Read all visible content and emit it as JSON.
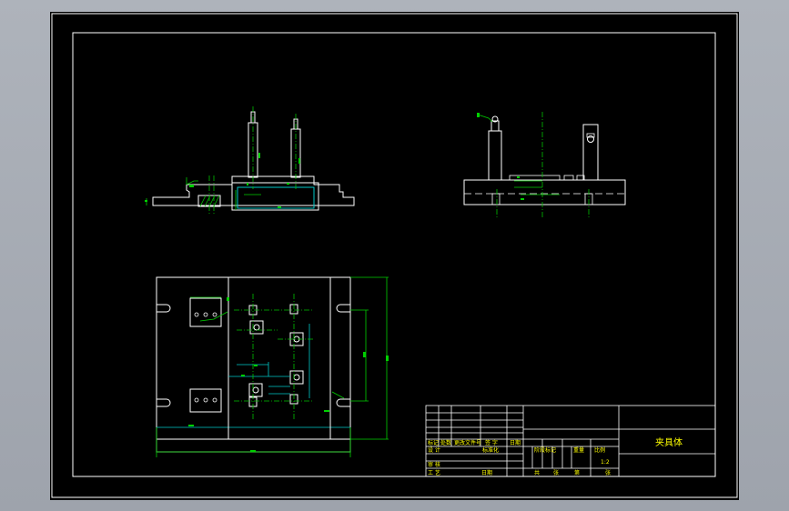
{
  "title_block": {
    "part_name": "夹具体",
    "scale": "1:2",
    "headers_row1": [
      "标记",
      "处数",
      "更改文件号",
      "签 字",
      "日期"
    ],
    "headers_row2": [
      "设 计",
      "标准化"
    ],
    "headers_row3": [
      "阶段标记",
      "重量",
      "比例"
    ],
    "headers_row4": [
      "审 核"
    ],
    "headers_row5": [
      "工 艺",
      "日期"
    ],
    "headers_row6": [
      "共",
      "张",
      "第",
      "张"
    ]
  },
  "colors": {
    "viewport_bg": "#000000",
    "frame": "#ffffff",
    "outline": "#ffffff",
    "dimension": "#00d000",
    "center_line": "#00c000",
    "feature": "#00c8c8",
    "title_text": "#ffff00"
  }
}
